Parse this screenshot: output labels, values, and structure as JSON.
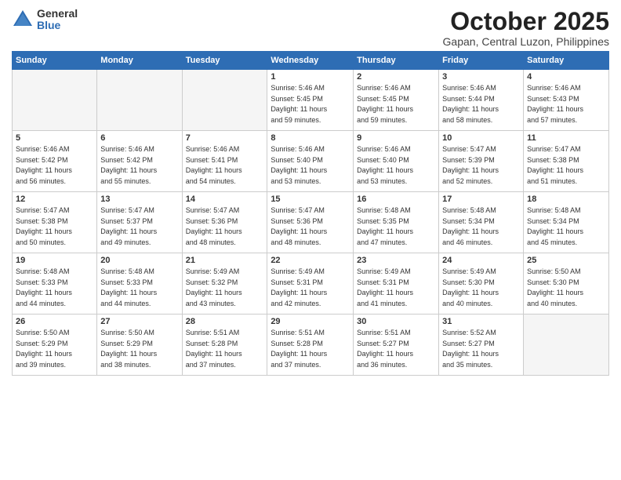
{
  "logo": {
    "general": "General",
    "blue": "Blue"
  },
  "title": "October 2025",
  "subtitle": "Gapan, Central Luzon, Philippines",
  "headers": [
    "Sunday",
    "Monday",
    "Tuesday",
    "Wednesday",
    "Thursday",
    "Friday",
    "Saturday"
  ],
  "weeks": [
    [
      {
        "day": "",
        "info": ""
      },
      {
        "day": "",
        "info": ""
      },
      {
        "day": "",
        "info": ""
      },
      {
        "day": "1",
        "info": "Sunrise: 5:46 AM\nSunset: 5:45 PM\nDaylight: 11 hours\nand 59 minutes."
      },
      {
        "day": "2",
        "info": "Sunrise: 5:46 AM\nSunset: 5:45 PM\nDaylight: 11 hours\nand 59 minutes."
      },
      {
        "day": "3",
        "info": "Sunrise: 5:46 AM\nSunset: 5:44 PM\nDaylight: 11 hours\nand 58 minutes."
      },
      {
        "day": "4",
        "info": "Sunrise: 5:46 AM\nSunset: 5:43 PM\nDaylight: 11 hours\nand 57 minutes."
      }
    ],
    [
      {
        "day": "5",
        "info": "Sunrise: 5:46 AM\nSunset: 5:42 PM\nDaylight: 11 hours\nand 56 minutes."
      },
      {
        "day": "6",
        "info": "Sunrise: 5:46 AM\nSunset: 5:42 PM\nDaylight: 11 hours\nand 55 minutes."
      },
      {
        "day": "7",
        "info": "Sunrise: 5:46 AM\nSunset: 5:41 PM\nDaylight: 11 hours\nand 54 minutes."
      },
      {
        "day": "8",
        "info": "Sunrise: 5:46 AM\nSunset: 5:40 PM\nDaylight: 11 hours\nand 53 minutes."
      },
      {
        "day": "9",
        "info": "Sunrise: 5:46 AM\nSunset: 5:40 PM\nDaylight: 11 hours\nand 53 minutes."
      },
      {
        "day": "10",
        "info": "Sunrise: 5:47 AM\nSunset: 5:39 PM\nDaylight: 11 hours\nand 52 minutes."
      },
      {
        "day": "11",
        "info": "Sunrise: 5:47 AM\nSunset: 5:38 PM\nDaylight: 11 hours\nand 51 minutes."
      }
    ],
    [
      {
        "day": "12",
        "info": "Sunrise: 5:47 AM\nSunset: 5:38 PM\nDaylight: 11 hours\nand 50 minutes."
      },
      {
        "day": "13",
        "info": "Sunrise: 5:47 AM\nSunset: 5:37 PM\nDaylight: 11 hours\nand 49 minutes."
      },
      {
        "day": "14",
        "info": "Sunrise: 5:47 AM\nSunset: 5:36 PM\nDaylight: 11 hours\nand 48 minutes."
      },
      {
        "day": "15",
        "info": "Sunrise: 5:47 AM\nSunset: 5:36 PM\nDaylight: 11 hours\nand 48 minutes."
      },
      {
        "day": "16",
        "info": "Sunrise: 5:48 AM\nSunset: 5:35 PM\nDaylight: 11 hours\nand 47 minutes."
      },
      {
        "day": "17",
        "info": "Sunrise: 5:48 AM\nSunset: 5:34 PM\nDaylight: 11 hours\nand 46 minutes."
      },
      {
        "day": "18",
        "info": "Sunrise: 5:48 AM\nSunset: 5:34 PM\nDaylight: 11 hours\nand 45 minutes."
      }
    ],
    [
      {
        "day": "19",
        "info": "Sunrise: 5:48 AM\nSunset: 5:33 PM\nDaylight: 11 hours\nand 44 minutes."
      },
      {
        "day": "20",
        "info": "Sunrise: 5:48 AM\nSunset: 5:33 PM\nDaylight: 11 hours\nand 44 minutes."
      },
      {
        "day": "21",
        "info": "Sunrise: 5:49 AM\nSunset: 5:32 PM\nDaylight: 11 hours\nand 43 minutes."
      },
      {
        "day": "22",
        "info": "Sunrise: 5:49 AM\nSunset: 5:31 PM\nDaylight: 11 hours\nand 42 minutes."
      },
      {
        "day": "23",
        "info": "Sunrise: 5:49 AM\nSunset: 5:31 PM\nDaylight: 11 hours\nand 41 minutes."
      },
      {
        "day": "24",
        "info": "Sunrise: 5:49 AM\nSunset: 5:30 PM\nDaylight: 11 hours\nand 40 minutes."
      },
      {
        "day": "25",
        "info": "Sunrise: 5:50 AM\nSunset: 5:30 PM\nDaylight: 11 hours\nand 40 minutes."
      }
    ],
    [
      {
        "day": "26",
        "info": "Sunrise: 5:50 AM\nSunset: 5:29 PM\nDaylight: 11 hours\nand 39 minutes."
      },
      {
        "day": "27",
        "info": "Sunrise: 5:50 AM\nSunset: 5:29 PM\nDaylight: 11 hours\nand 38 minutes."
      },
      {
        "day": "28",
        "info": "Sunrise: 5:51 AM\nSunset: 5:28 PM\nDaylight: 11 hours\nand 37 minutes."
      },
      {
        "day": "29",
        "info": "Sunrise: 5:51 AM\nSunset: 5:28 PM\nDaylight: 11 hours\nand 37 minutes."
      },
      {
        "day": "30",
        "info": "Sunrise: 5:51 AM\nSunset: 5:27 PM\nDaylight: 11 hours\nand 36 minutes."
      },
      {
        "day": "31",
        "info": "Sunrise: 5:52 AM\nSunset: 5:27 PM\nDaylight: 11 hours\nand 35 minutes."
      },
      {
        "day": "",
        "info": ""
      }
    ]
  ]
}
